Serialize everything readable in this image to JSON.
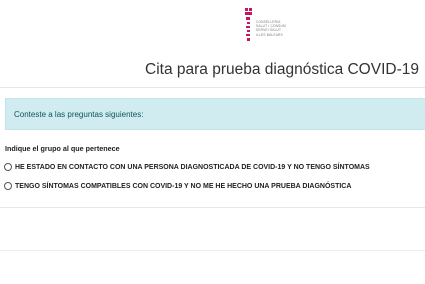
{
  "header": {
    "logo_lines": [
      "CONSELLERIA",
      "SALUT I CONSUM",
      "SERVEI SALUT",
      "ILLES BALEARS"
    ],
    "title": "Cita para prueba diagnóstica COVID-19"
  },
  "alert": {
    "text": "Conteste a las preguntas siguientes:",
    "background": "#d1ecf1",
    "text_color": "#0c5460"
  },
  "form": {
    "question": "Indique el grupo al que pertenece",
    "options": [
      {
        "label": "HE ESTADO EN CONTACTO CON UNA PERSONA DIAGNOSTICADA DE COVID-19 Y NO TENGO SÍNTOMAS",
        "selected": false
      },
      {
        "label": "TENGO SÍNTOMAS COMPATIBLES CON COVID-19 Y NO ME HE HECHO UNA PRUEBA DIAGNÓSTICA",
        "selected": false
      }
    ]
  },
  "brand": {
    "logo_accent": "#c2185b"
  }
}
